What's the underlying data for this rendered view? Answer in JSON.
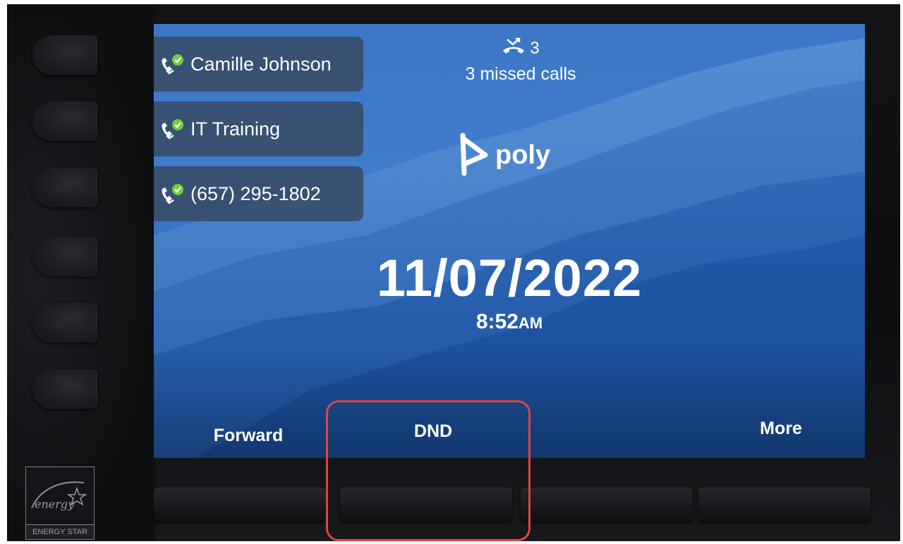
{
  "lines": [
    {
      "label": "Camille Johnson",
      "icon": "phone-registered-icon"
    },
    {
      "label": "IT Training",
      "icon": "phone-registered-icon"
    },
    {
      "label": "(657) 295-1802",
      "icon": "phone-registered-icon"
    }
  ],
  "missed_calls": {
    "count": "3",
    "label": "3 missed calls",
    "icon": "missed-call-icon"
  },
  "brand": {
    "name": "poly"
  },
  "date": "11/07/2022",
  "time": {
    "hm": "8:52",
    "ampm": "AM"
  },
  "softkeys": {
    "forward": "Forward",
    "dnd": "DND",
    "more": "More"
  },
  "energy_star": {
    "label": "ENERGY STAR",
    "logo_text": "energy"
  },
  "colors": {
    "highlight": "#e2443f",
    "status_green": "#6fd03a"
  }
}
